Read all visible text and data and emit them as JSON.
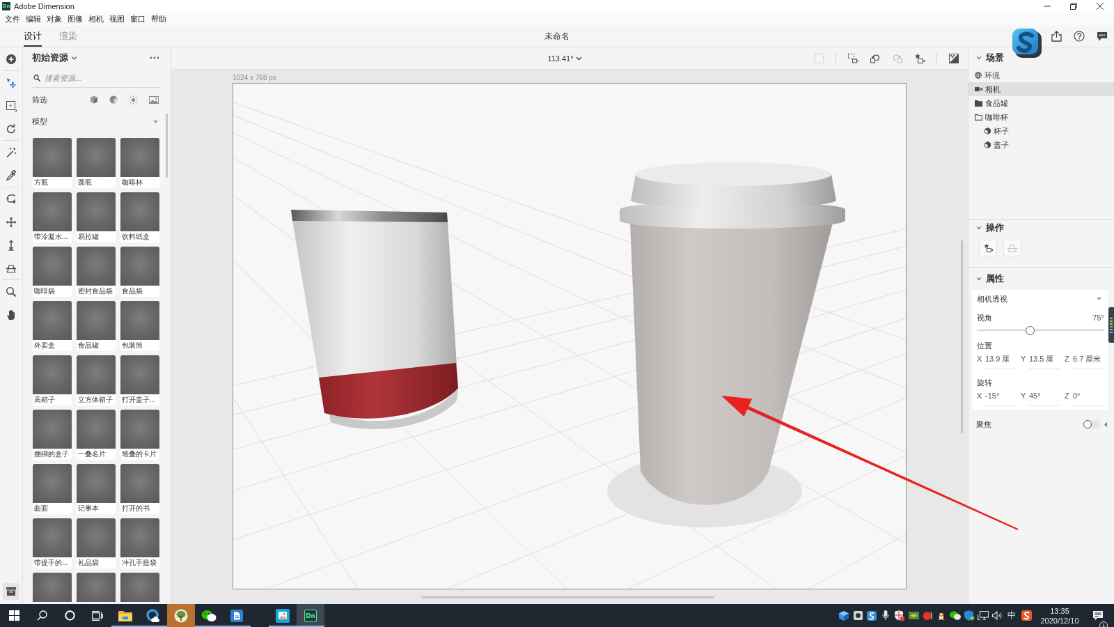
{
  "window": {
    "logo": "Dn",
    "title": "Adobe Dimension"
  },
  "menu": [
    "文件",
    "编辑",
    "对象",
    "图像",
    "相机",
    "视图",
    "窗口",
    "帮助"
  ],
  "mode_tabs": [
    {
      "label": "设计",
      "selected": true
    },
    {
      "label": "渲染",
      "selected": false
    }
  ],
  "document_title": "未命名",
  "tool_groups": [
    [
      {
        "kind": "add",
        "selected": false
      }
    ],
    [
      {
        "kind": "select",
        "selected": true
      },
      {
        "kind": "marquee",
        "selected": false
      },
      {
        "kind": "rotate",
        "selected": false
      }
    ],
    [
      {
        "kind": "magic_wand",
        "selected": false
      },
      {
        "kind": "eyedropper",
        "selected": false
      }
    ],
    [
      {
        "kind": "orbit",
        "selected": false
      },
      {
        "kind": "pan",
        "selected": false
      },
      {
        "kind": "dolly",
        "selected": false
      },
      {
        "kind": "horizon",
        "selected": false
      }
    ],
    [
      {
        "kind": "zoom",
        "selected": false
      },
      {
        "kind": "hand",
        "selected": false
      }
    ]
  ],
  "assets_panel": {
    "title": "初始资源",
    "search": {
      "placeholder": "搜索资源..."
    },
    "filter_label": "筛选",
    "category": "模型",
    "items": [
      {
        "kind": "tile",
        "label": "方瓶"
      },
      {
        "kind": "tile",
        "label": "圆瓶"
      },
      {
        "kind": "tile",
        "label": "咖啡杯"
      },
      {
        "kind": "tile",
        "label": "带冷凝水..."
      },
      {
        "kind": "tile",
        "label": "易拉罐"
      },
      {
        "kind": "tile",
        "label": "饮料纸盒"
      },
      {
        "kind": "tile",
        "label": "咖啡袋"
      },
      {
        "kind": "tile",
        "label": "密封食品袋"
      },
      {
        "kind": "tile",
        "label": "食品袋"
      },
      {
        "kind": "tile",
        "label": "外卖盒"
      },
      {
        "kind": "tile",
        "label": "食品罐"
      },
      {
        "kind": "tile",
        "label": "包装筒"
      },
      {
        "kind": "tile",
        "label": "高箱子"
      },
      {
        "kind": "tile",
        "label": "立方体箱子"
      },
      {
        "kind": "tile",
        "label": "打开盖子..."
      },
      {
        "kind": "tile",
        "label": "捆绑的盒子"
      },
      {
        "kind": "tile",
        "label": "一叠名片"
      },
      {
        "kind": "tile",
        "label": "堆叠的卡片"
      },
      {
        "kind": "tile",
        "label": "曲面"
      },
      {
        "kind": "tile",
        "label": "记事本"
      },
      {
        "kind": "tile",
        "label": "打开的书"
      },
      {
        "kind": "tile",
        "label": "带提手的..."
      },
      {
        "kind": "tile",
        "label": "礼品袋"
      },
      {
        "kind": "tile",
        "label": "冲孔手提袋"
      },
      {
        "kind": "cut_off"
      },
      {
        "kind": "cut_off"
      },
      {
        "kind": "cut_off"
      }
    ]
  },
  "viewport": {
    "angle": "113.41°",
    "tools": [
      {
        "kind": "frame",
        "disabled": true
      },
      {
        "kind": "camera_select",
        "disabled": false
      },
      {
        "kind": "undo",
        "disabled": false
      },
      {
        "kind": "redo",
        "disabled": true
      },
      {
        "kind": "bookmark",
        "disabled": false
      },
      {
        "kind": "render_preview",
        "disabled": false
      }
    ],
    "canvas_label": "1024 x 768 px"
  },
  "scene_panel": {
    "title": "场景",
    "expanded": true,
    "tree": [
      {
        "label": "环境",
        "kind": "environment",
        "selected": false
      },
      {
        "label": "相机",
        "kind": "camera",
        "selected": true
      },
      {
        "label": "食品罐",
        "kind": "group",
        "selected": false,
        "expanded": false
      },
      {
        "label": "咖啡杯",
        "kind": "group",
        "selected": false,
        "expanded": true,
        "children": [
          {
            "label": "杯子",
            "kind": "model",
            "selected": false
          },
          {
            "label": "盖子",
            "kind": "model",
            "selected": false
          }
        ]
      }
    ]
  },
  "actions_panel": {
    "title": "操作",
    "expanded": true,
    "buttons": [
      {
        "kind": "bookmark",
        "disabled": false
      },
      {
        "kind": "horizon",
        "disabled": true
      }
    ]
  },
  "properties_panel": {
    "title": "属性",
    "expanded": true,
    "projection": "相机透视",
    "fov": {
      "label": "视角",
      "value": "75°",
      "level": 0.42
    },
    "position": {
      "label": "位置",
      "fields": [
        {
          "axis": "X",
          "value": "13.9 厘"
        },
        {
          "axis": "Y",
          "value": "13.5 厘"
        },
        {
          "axis": "Z",
          "value": "6.7 厘米"
        }
      ]
    },
    "rotation": {
      "label": "旋转",
      "fields": [
        {
          "axis": "X",
          "value": "-15°"
        },
        {
          "axis": "Y",
          "value": "45°"
        },
        {
          "axis": "Z",
          "value": "0°"
        }
      ]
    },
    "focus": {
      "label": "聚焦",
      "on": false
    }
  },
  "taskbar": {
    "apps": [
      {
        "kind": "explorer",
        "running": true,
        "flashing": false,
        "focused": false
      },
      {
        "kind": "browser",
        "running": true,
        "flashing": false,
        "focused": false
      },
      {
        "kind": "tree",
        "running": false,
        "flashing": true,
        "focused": false
      },
      {
        "kind": "chat",
        "running": true,
        "flashing": false,
        "focused": false
      },
      {
        "kind": "writer",
        "running": true,
        "flashing": false,
        "focused": false
      },
      {
        "kind": "picture",
        "running": true,
        "flashing": false,
        "focused": false
      },
      {
        "kind": "dimension",
        "label": "Dn",
        "running": true,
        "flashing": false,
        "focused": true
      }
    ],
    "ime": "中",
    "time": "13:35",
    "date": "2020/12/10",
    "notifications": "1"
  }
}
